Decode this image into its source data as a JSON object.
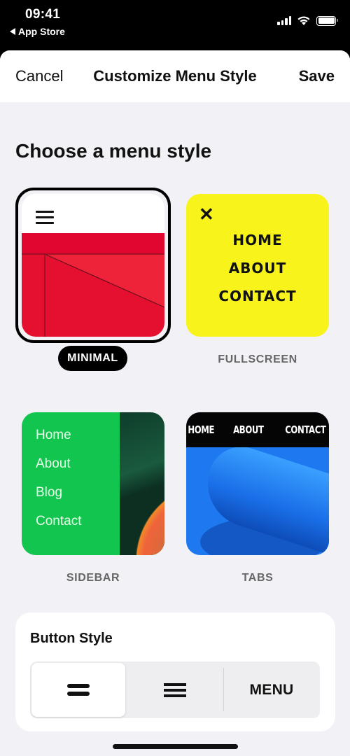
{
  "status_bar": {
    "time": "09:41",
    "back_app": "App Store",
    "icons": [
      "cellular-signal-icon",
      "wifi-icon",
      "battery-icon"
    ]
  },
  "nav": {
    "cancel_label": "Cancel",
    "title": "Customize Menu Style",
    "save_label": "Save"
  },
  "section_title": "Choose a menu style",
  "menu_styles": [
    {
      "id": "minimal",
      "label": "MINIMAL",
      "selected": true,
      "preview": {
        "icon": "hamburger-icon",
        "bg_color": "#e5102f"
      }
    },
    {
      "id": "fullscreen",
      "label": "FULLSCREEN",
      "selected": false,
      "preview": {
        "icon": "close-icon",
        "close_glyph": "✕",
        "links": [
          "HOME",
          "ABOUT",
          "CONTACT"
        ],
        "bg_color": "#f8f31b"
      }
    },
    {
      "id": "sidebar",
      "label": "SIDEBAR",
      "selected": false,
      "preview": {
        "links": [
          "Home",
          "About",
          "Blog",
          "Contact"
        ],
        "bg_color": "#12c54f"
      }
    },
    {
      "id": "tabs",
      "label": "TABS",
      "selected": false,
      "preview": {
        "links": [
          "HOME",
          "ABOUT",
          "CONTACT"
        ],
        "bg_color": "#1e78f0"
      }
    }
  ],
  "button_style": {
    "heading": "Button Style",
    "options": [
      {
        "id": "two-line",
        "icon": "two-line-menu-icon",
        "selected": true
      },
      {
        "id": "three-line",
        "icon": "hamburger-icon",
        "selected": false
      },
      {
        "id": "text",
        "label": "MENU",
        "selected": false
      }
    ]
  }
}
